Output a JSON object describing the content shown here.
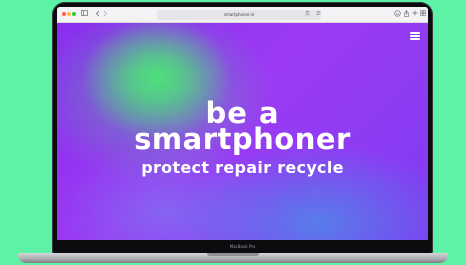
{
  "device": {
    "label": "MacBook Pro"
  },
  "browser": {
    "address": "smartphoner.nl",
    "icons": [
      "sidebar-icon",
      "back-icon",
      "forward-icon",
      "shield-icon",
      "translate-icon",
      "reader-icon",
      "share-icon",
      "new-tab-icon",
      "tab-overview-icon"
    ]
  },
  "website": {
    "menu_icon": "hamburger-menu-icon",
    "headline_line1": "be a",
    "headline_line2": "smartphoner",
    "tagline": "protect repair recycle"
  },
  "colors": {
    "background": "#5ef2a6",
    "hero_purple": "#8a2bf0",
    "hero_green": "#4ee07a",
    "text": "#ffffff"
  }
}
